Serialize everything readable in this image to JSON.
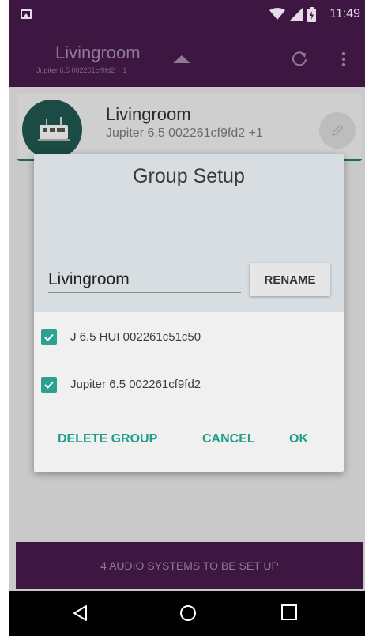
{
  "status_bar": {
    "time": "11:49",
    "icons": [
      "gallery-icon",
      "wifi-icon",
      "signal-icon",
      "battery-charging-icon"
    ]
  },
  "app_bar": {
    "title": "Livingroom",
    "subtitle": "Jupiter 6.5 002261cf9fd2 + 1",
    "icons": [
      "caret-up-icon",
      "refresh-icon",
      "overflow-menu-icon"
    ]
  },
  "group_card": {
    "name": "Livingroom",
    "description": "Jupiter 6.5 002261cf9fd2 +1",
    "icons": [
      "speaker-thumbnail",
      "edit-pencil-icon"
    ]
  },
  "dialog": {
    "title": "Group Setup",
    "group_name_value": "Livingroom",
    "rename_label": "RENAME",
    "devices": [
      {
        "label": "J 6.5 HUI 002261c51c50",
        "checked": true
      },
      {
        "label": "Jupiter 6.5 002261cf9fd2",
        "checked": true
      }
    ],
    "actions": {
      "delete_label": "DELETE GROUP",
      "cancel_label": "CANCEL",
      "ok_label": "OK"
    },
    "accent_color": "#1f9e8c"
  },
  "setup_bar": {
    "label": "4 AUDIO SYSTEMS TO BE SET UP"
  },
  "nav_bar": {
    "icons": [
      "back-icon",
      "home-icon",
      "recents-icon"
    ]
  },
  "colors": {
    "primary": "#3d1641",
    "accent": "#2aa192",
    "dialog_header": "#d7dde1"
  }
}
